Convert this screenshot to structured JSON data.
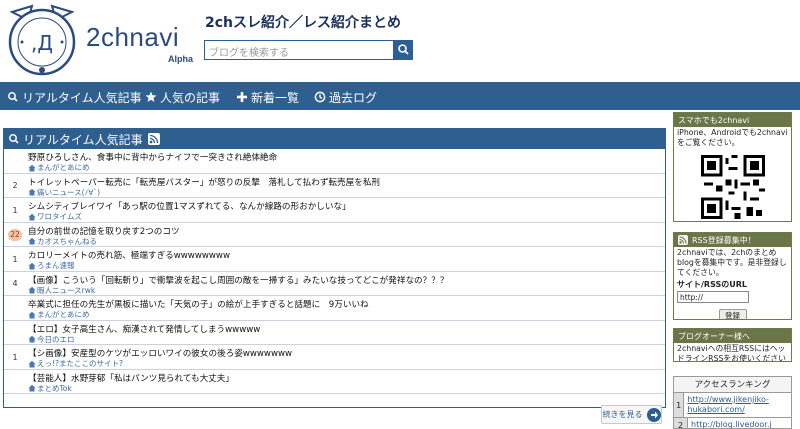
{
  "header": {
    "logo_text": "2chnavi",
    "logo_sub": "Alpha",
    "site_title": "2chスレ紹介／レス紹介まとめ",
    "search_placeholder": "ブログを検索する"
  },
  "nav": {
    "items": [
      {
        "label": "リアルタイム人気記事",
        "icon": "search-icon"
      },
      {
        "label": "人気の記事",
        "icon": "star-icon"
      },
      {
        "label": "新着一覧",
        "icon": "plus-icon"
      },
      {
        "label": "過去ログ",
        "icon": "clock-icon"
      }
    ]
  },
  "main": {
    "heading": "リアルタイム人気記事",
    "articles": [
      {
        "count": "",
        "title": "野原ひろしさん、食事中に背中からナイフで一突きされ絶体絶命",
        "source": "まんがとあにめ",
        "hot": false
      },
      {
        "count": "2",
        "title": "トイレットペーパー転売に「転売屋バスター」が怒りの反撃　落札して払わず転売屋を私刑",
        "source": "痛いニュース(ﾉ∀`)",
        "hot": false
      },
      {
        "count": "1",
        "title": "シムシティブレイワイ「あっ駅の位置1マスずれてる、なんか線路の形おかしいな」",
        "source": "ワロタイムズ",
        "hot": false
      },
      {
        "count": "22",
        "title": "自分の前世の記憶を取り戻す2つのコツ",
        "source": "カオスちゃんねる",
        "hot": true
      },
      {
        "count": "1",
        "title": "カロリーメイトの売れ筋、極端すぎるwwwwwwww",
        "source": "ろまん速報",
        "hot": false
      },
      {
        "count": "4",
        "title": "【画像】こういう「回転斬り」で衝撃波を起こし周囲の敵を一掃する」みたいな技ってどこが発祥なの？？？",
        "source": "暇人ニュースrwk",
        "hot": false
      },
      {
        "count": "",
        "title": "卒業式に担任の先生が黒板に描いた「天気の子」の絵が上手すぎると話題に　9万いいね",
        "source": "まんがとあにめ",
        "hot": false
      },
      {
        "count": "",
        "title": "【エロ】女子高生さん、痴漢されて発情してしまうwwwww",
        "source": "今日のエロ",
        "hot": false
      },
      {
        "count": "1",
        "title": "【シ画像】安産型のケツがエッロいワイの彼女の後ろ姿wwwwwww",
        "source": "えっ!?またここのサイト?",
        "hot": false
      },
      {
        "count": "",
        "title": "【芸能人】水野芽郁「私はパンツ見られても大丈夫」",
        "source": "まとめTok",
        "hot": false
      }
    ],
    "more_label": "続きを見る"
  },
  "sidebar": {
    "mobile": {
      "heading": "スマホでも2chnavi",
      "text": "iPhone、Androidでも2chnaviをご覧ください。"
    },
    "rss": {
      "heading": "RSS登録募集中！",
      "text": "2chnaviでは、2chのまとめblogを募集中です。是非登録してください。",
      "url_label": "サイト/RSSのURL",
      "url_value": "http://",
      "submit_label": "登録"
    },
    "owner": {
      "heading": "ブログオーナー様へ",
      "text": "2chnaviへの相互RSSにはヘッドラインRSSをお使いください"
    },
    "ranking": {
      "heading": "アクセスランキング",
      "rows": [
        {
          "rank": "1",
          "url": "http://www.jikenjiko-hukabori.com/"
        },
        {
          "rank": "2",
          "url": "http://blog.livedoor.j"
        }
      ]
    }
  }
}
